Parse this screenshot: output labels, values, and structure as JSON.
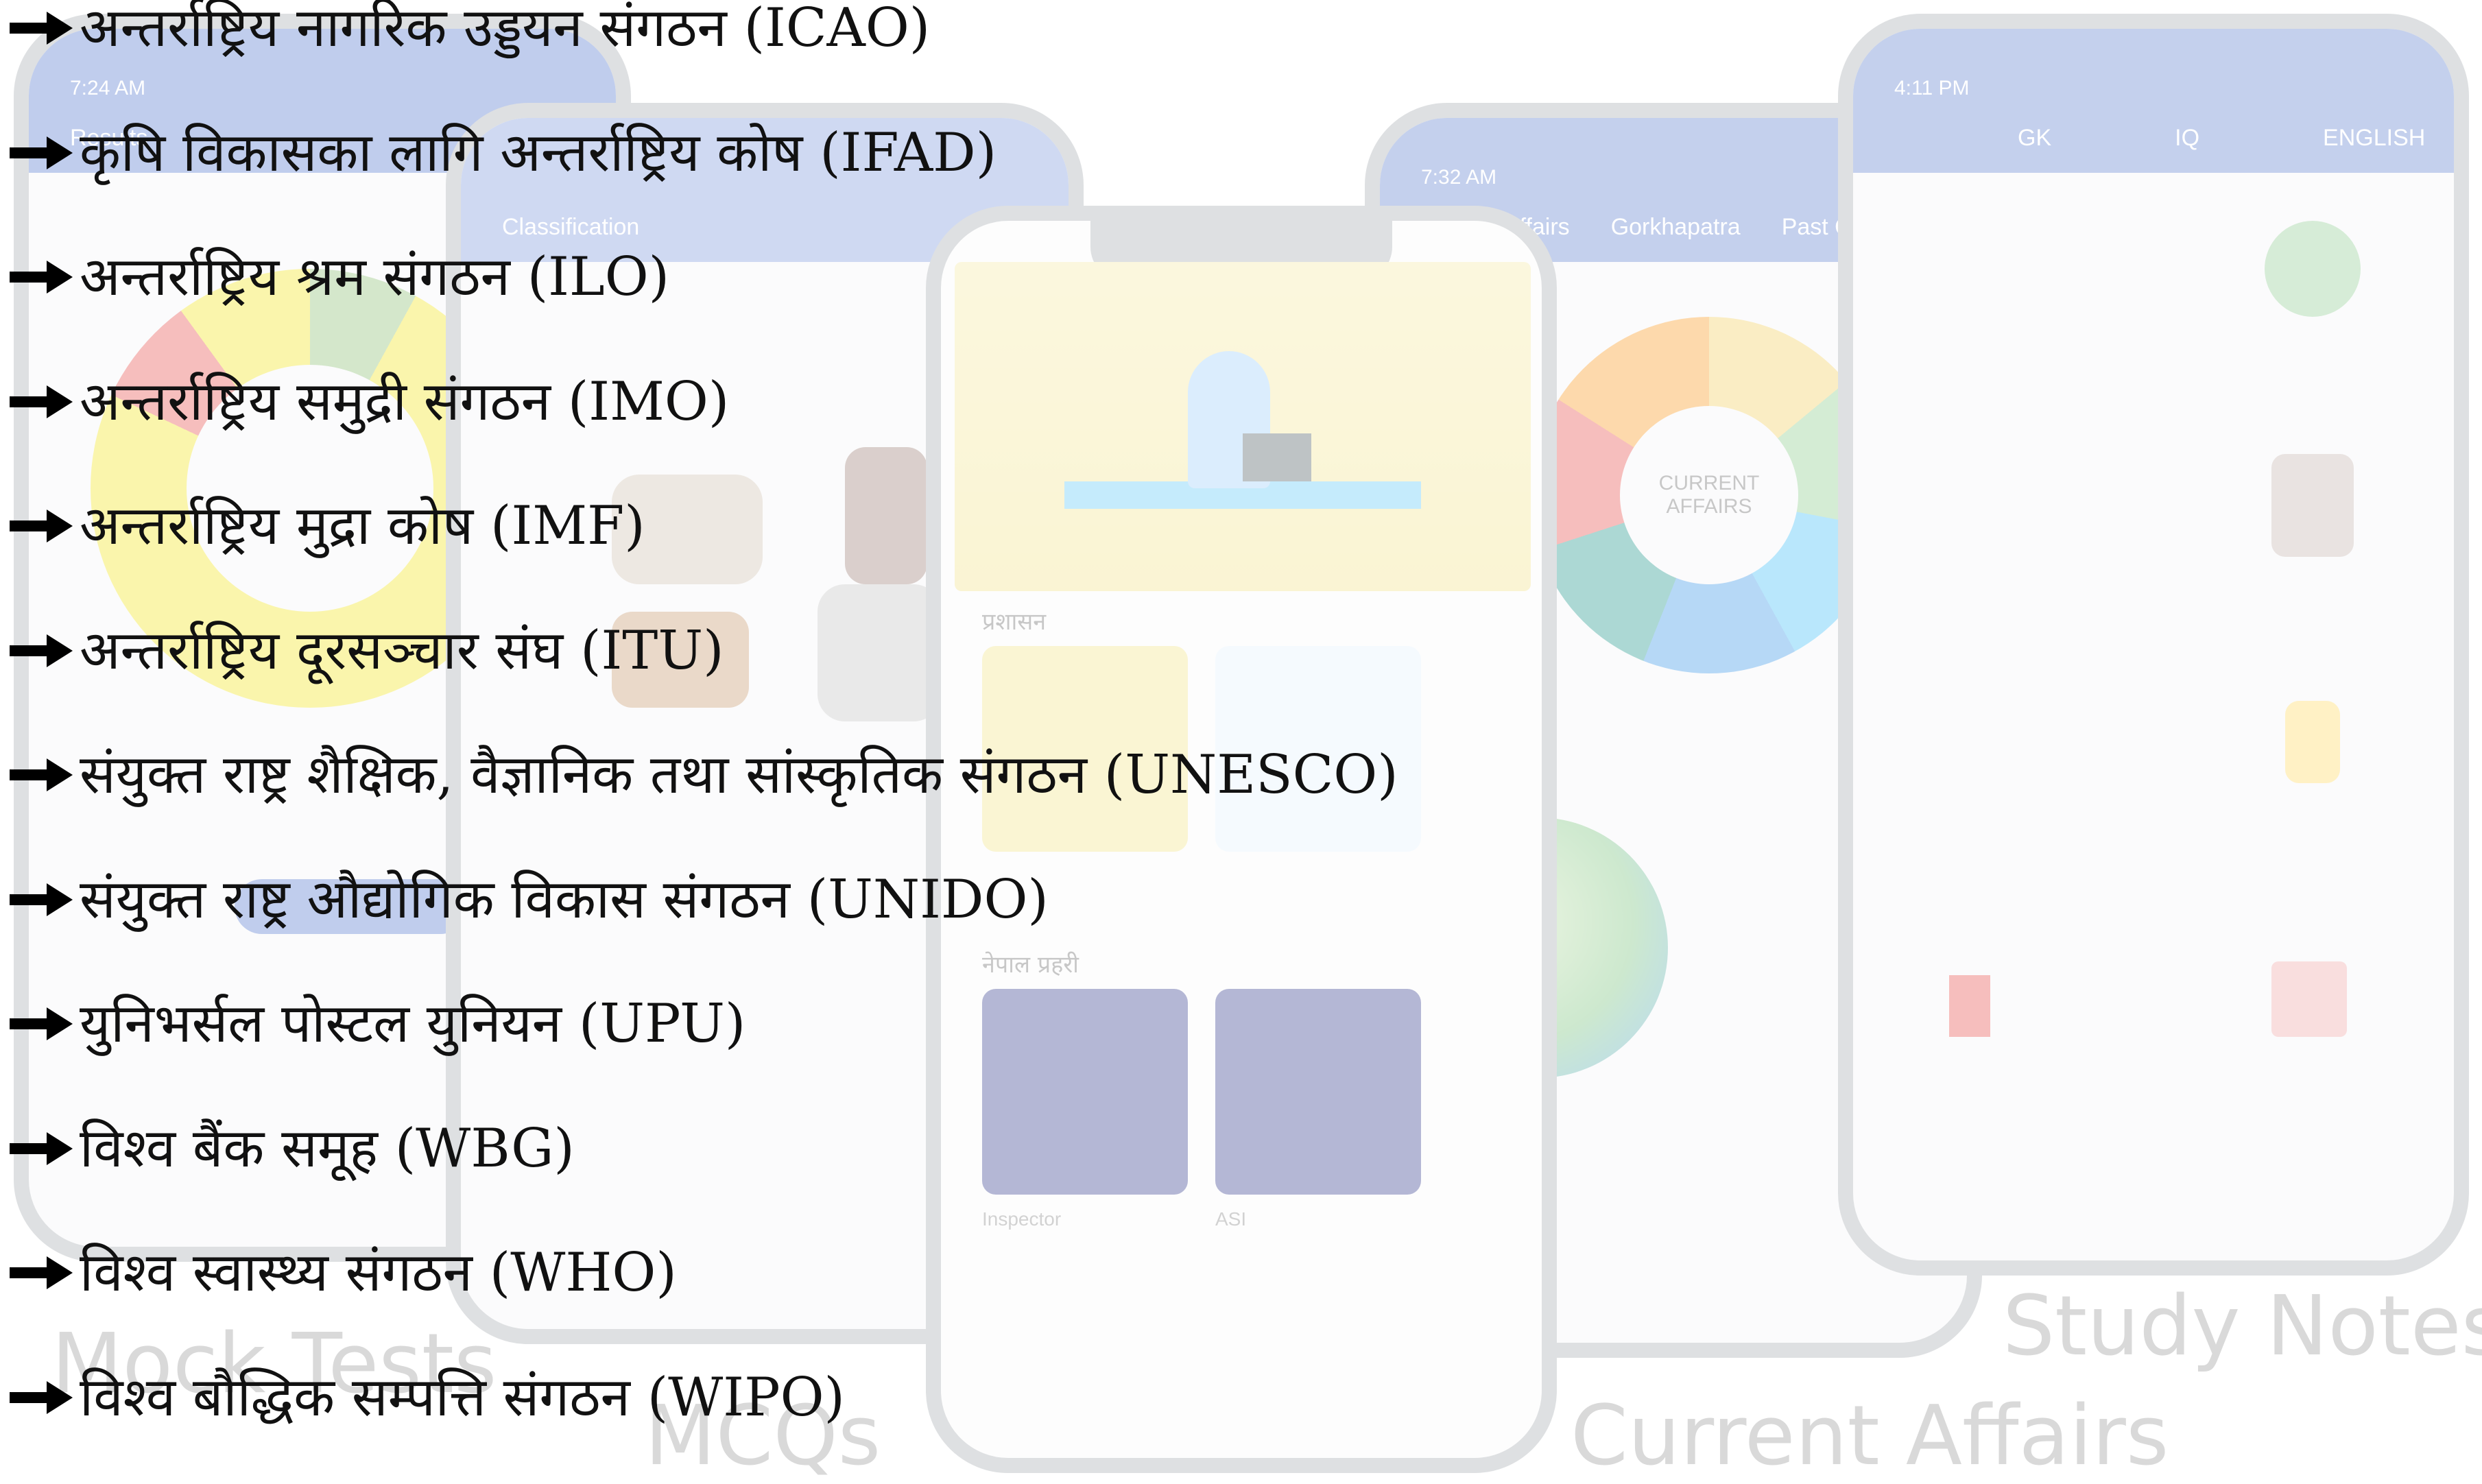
{
  "organizations": [
    {
      "name": "अन्तर्राष्ट्रिय नागरिक उड्डयन संगठन",
      "abbr": "(ICAO)"
    },
    {
      "name": "कृषि विकासका लागि अन्तर्राष्ट्रिय कोष",
      "abbr": "(IFAD)"
    },
    {
      "name": "अन्तर्राष्ट्रिय श्रम संगठन",
      "abbr": "(ILO)"
    },
    {
      "name": "अन्तर्राष्ट्रिय समुद्री संगठन",
      "abbr": "(IMO)"
    },
    {
      "name": "अन्तर्राष्ट्रिय मुद्रा कोष",
      "abbr": "(IMF)"
    },
    {
      "name": "अन्तर्राष्ट्रिय दूरसञ्चार संघ",
      "abbr": "(ITU)"
    },
    {
      "name": "संयुक्त राष्ट्र शैक्षिक, वैज्ञानिक तथा सांस्कृतिक संगठन",
      "abbr": "(UNESCO)"
    },
    {
      "name": "संयुक्त राष्ट्र औद्योगिक विकास संगठन",
      "abbr": "(UNIDO)"
    },
    {
      "name": "युनिभर्सल पोस्टल युनियन",
      "abbr": "(UPU)"
    },
    {
      "name": "विश्व बैंक समूह",
      "abbr": "(WBG)"
    },
    {
      "name": "विश्व स्वास्थ्य संगठन",
      "abbr": "(WHO)"
    },
    {
      "name": "विश्व बौद्धिक सम्पत्ति संगठन",
      "abbr": "(WIPO)"
    }
  ],
  "background": {
    "captions": {
      "mock_tests": "Mock Tests",
      "mcqs": "MCQs",
      "current_affairs": "Current Affairs",
      "study_notes": "Study Notes"
    },
    "phones": {
      "mock": {
        "time": "7:24 AM",
        "tabs": [
          "Results"
        ]
      },
      "mcq": {
        "time": "",
        "tabs": [
          "Classification"
        ]
      },
      "center": {
        "tiles": [
          "प्रशासन",
          "नेपाल प्रहरी",
          "Inspector",
          "ASI"
        ]
      },
      "current": {
        "time": "7:32 AM",
        "tabs": [
          "Current Affairs",
          "Gorkhapatra",
          "Past Questions"
        ],
        "badge": "CURRENT AFFAIRS"
      },
      "study": {
        "time": "4:11 PM",
        "tabs": [
          "GK",
          "IQ",
          "ENGLISH"
        ]
      }
    }
  }
}
